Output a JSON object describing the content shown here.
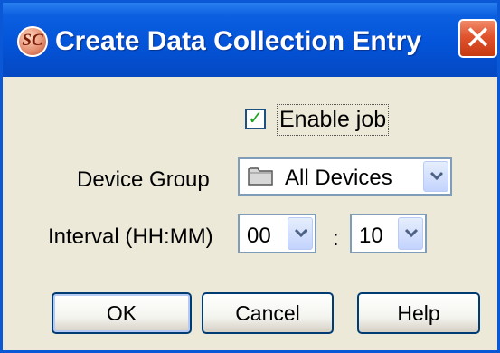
{
  "window": {
    "title": "Create Data Collection Entry",
    "app_icon_text": "SC",
    "close_glyph": "✕"
  },
  "form": {
    "enable_job": {
      "label": "Enable job",
      "checked": true,
      "check_glyph": "✓"
    },
    "device_group": {
      "label": "Device Group",
      "value": "All Devices",
      "icon": "folder-icon"
    },
    "interval": {
      "label": "Interval (HH:MM)",
      "hours": "00",
      "separator": ":",
      "minutes": "10"
    }
  },
  "buttons": {
    "ok": "OK",
    "cancel": "Cancel",
    "help": "Help"
  },
  "colors": {
    "title_bar": "#0454d9",
    "close": "#e0532d",
    "body": "#ece9d8",
    "check": "#21a121"
  }
}
